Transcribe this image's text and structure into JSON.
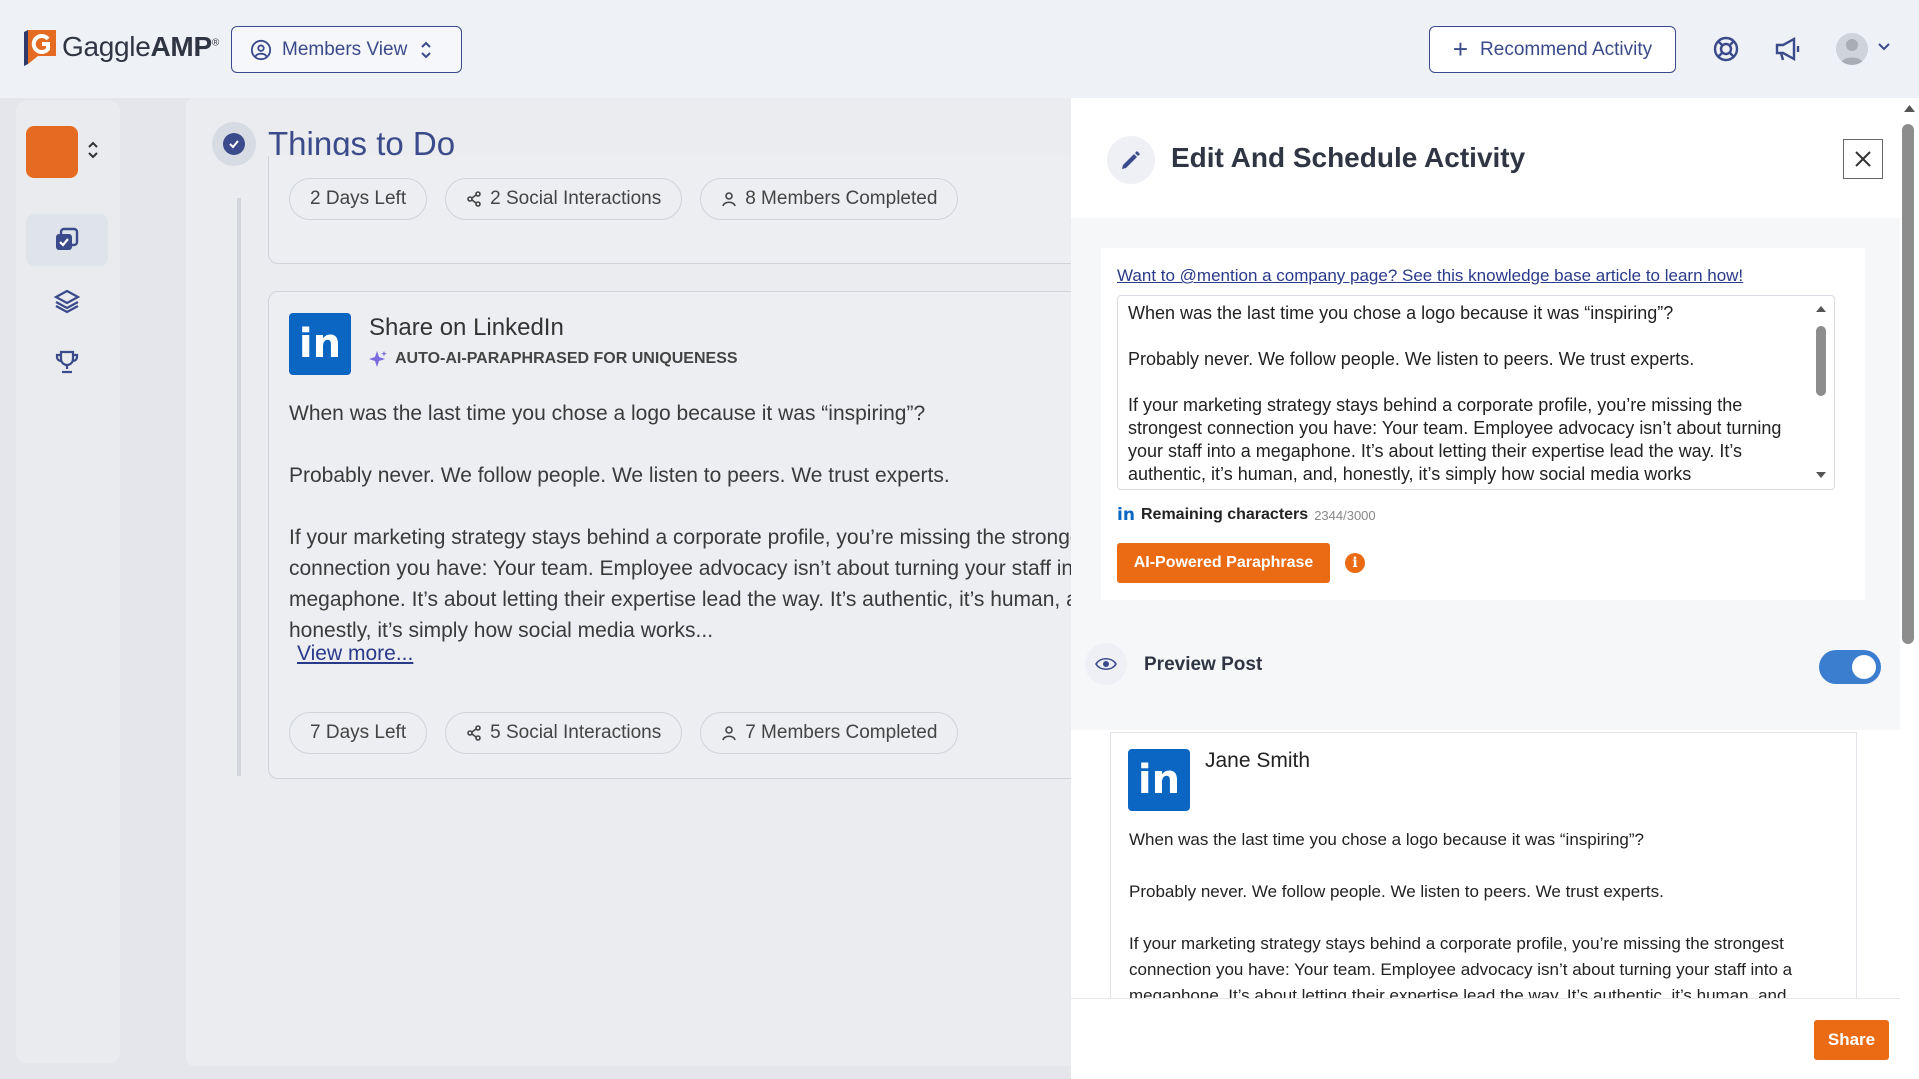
{
  "app": {
    "logo_text_a": "Gaggle",
    "logo_text_b": "AMP",
    "logo_reg": "®"
  },
  "topbar": {
    "view_selector_label": "Members View",
    "recommend_label": "Recommend Activity"
  },
  "main": {
    "title": "Things to Do",
    "card1": {
      "pills": [
        "2 Days Left",
        "2 Social Interactions",
        "8 Members Completed"
      ]
    },
    "card2": {
      "title": "Share on LinkedIn",
      "ai_tag": "AUTO-AI-PARAPHRASED FOR UNIQUENESS",
      "body": [
        "When was the last time you chose a logo because it was “inspiring”?",
        "Probably never. We follow people. We listen to peers. We trust experts.",
        "If your marketing strategy stays behind a corporate profile, you’re missing the strongest connection you have: Your team. Employee advocacy isn’t about turning your staff into a megaphone. It’s about letting their expertise lead the way. It’s authentic, it’s human, and, honestly, it’s simply how social media works..."
      ],
      "view_more": "View more...",
      "pills": [
        "7 Days Left",
        "5 Social Interactions",
        "7 Members Completed"
      ]
    }
  },
  "panel": {
    "title": "Edit And Schedule Activity",
    "kb_link": "Want to @mention a company page? See this knowledge base article to learn how!",
    "editor_text": [
      "When was the last time you chose a logo because it was “inspiring”?",
      "Probably never. We follow people. We listen to peers. We trust experts.",
      "If your marketing strategy stays behind a corporate profile, you’re missing the strongest connection you have: Your team. Employee advocacy isn’t about turning your staff into a megaphone. It’s about letting their expertise lead the way. It’s authentic, it’s human, and, honestly, it’s simply how social media works"
    ],
    "remaining_label": "Remaining characters",
    "remaining_count": "2344/3000",
    "ai_button": "AI-Powered Paraphrase",
    "preview_label": "Preview Post",
    "preview_toggle_on": true,
    "preview": {
      "author": "Jane Smith",
      "body": [
        "When was the last time you chose a logo because it was “inspiring”?",
        "Probably never. We follow people. We listen to peers. We trust experts.",
        "If your marketing strategy stays behind a corporate profile, you’re missing the strongest connection you have: Your team. Employee advocacy isn’t about turning your staff into a megaphone. It’s about letting their expertise lead the way. It’s authentic, it’s human, and, honestly, it’s simply how social media works."
      ]
    },
    "share_button": "Share"
  },
  "icons": {
    "linkedin_glyph": "in"
  },
  "colors": {
    "brand_navy": "#3b4a8a",
    "accent_orange": "#ea6b14",
    "linkedin_blue": "#0a66c2",
    "toggle_blue": "#3b7ecf"
  }
}
